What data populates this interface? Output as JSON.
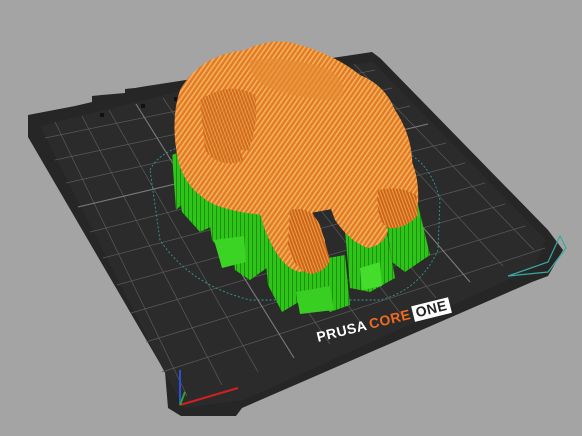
{
  "viewport": {
    "background_color": "#a4a4a4",
    "bed_color": "#262626",
    "grid_color": "#5c5c5c",
    "model_color": "#e07a2a",
    "support_color": "#33d11a",
    "skirt_color": "#35a4a0"
  },
  "bed": {
    "brand_part1": "PRUSA",
    "brand_part2": "CORE",
    "brand_part3": "ONE",
    "brand_color_1": "#ffffff",
    "brand_color_2": "#ed6b21",
    "brand_color_3": "#ffffff"
  },
  "axes": {
    "x_color": "#d02020",
    "y_color": "#2aa52a",
    "z_color": "#2a4fd8"
  }
}
